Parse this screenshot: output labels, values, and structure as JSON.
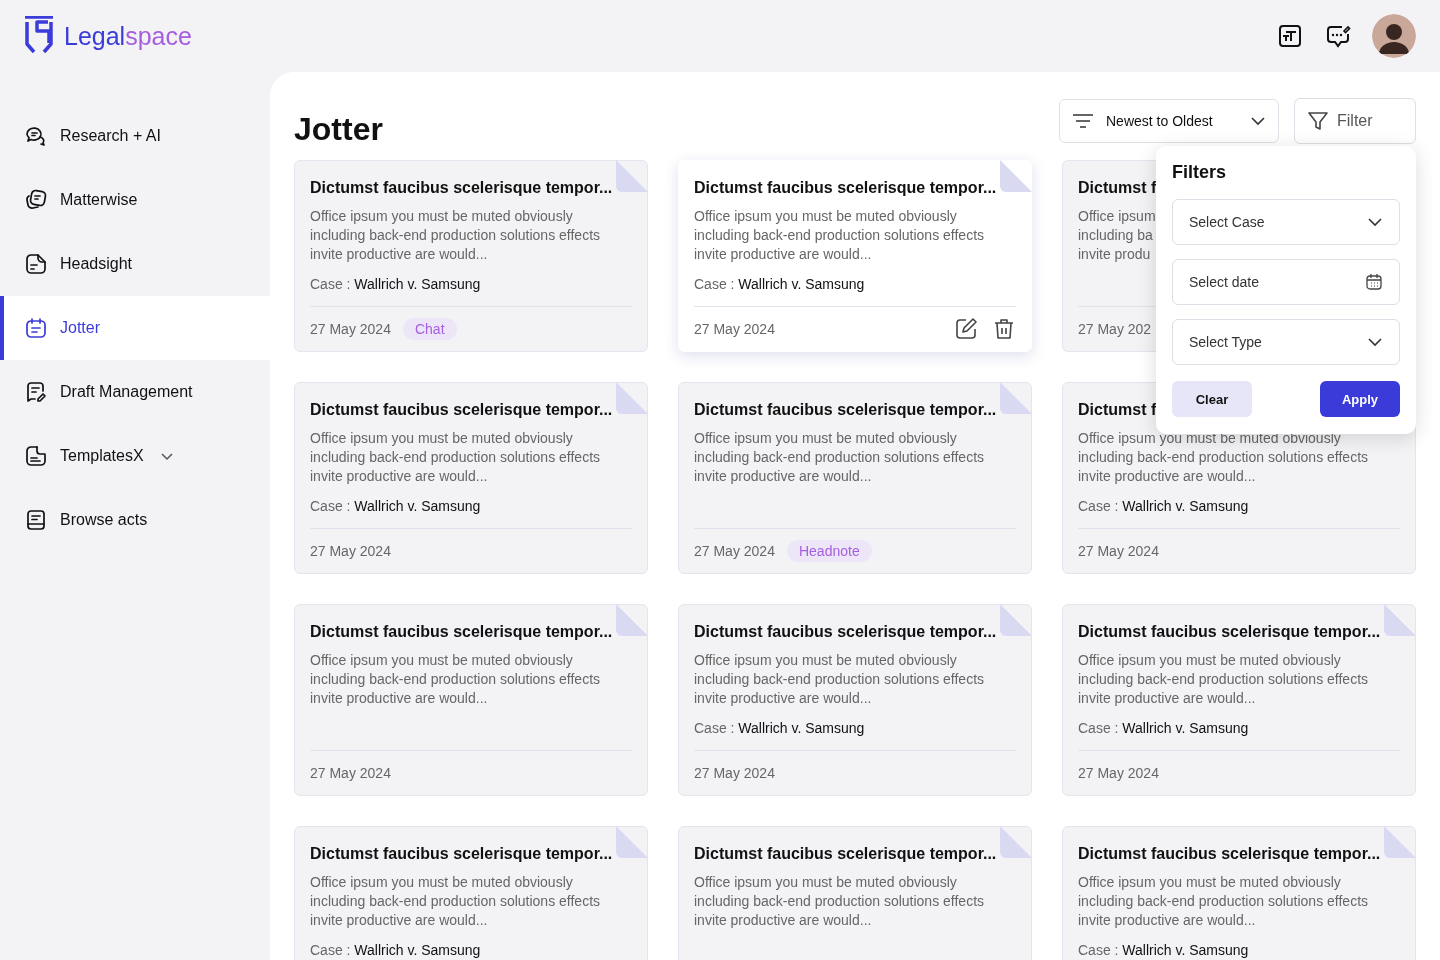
{
  "logo": {
    "part_1": "Legal",
    "part_2": "space"
  },
  "sidebar": {
    "items": [
      {
        "label": "Research + AI",
        "selected": false,
        "kind": "link"
      },
      {
        "label": "Matterwise",
        "selected": false,
        "kind": "link"
      },
      {
        "label": "Headsight",
        "selected": false,
        "kind": "link"
      },
      {
        "label": "Jotter",
        "selected": true,
        "kind": "link"
      },
      {
        "label": "Draft Management",
        "selected": false,
        "kind": "link"
      },
      {
        "label": "TemplatesX",
        "selected": false,
        "kind": "group"
      },
      {
        "label": "Browse acts",
        "selected": false,
        "kind": "link"
      }
    ]
  },
  "page": {
    "title": "Jotter"
  },
  "sort": {
    "value": "Newest to Oldest"
  },
  "filter_button": {
    "label": "Filter"
  },
  "filters": {
    "title": "Filters",
    "case_placeholder": "Select Case",
    "date_placeholder": "Select date",
    "type_placeholder": "Select Type",
    "clear": "Clear",
    "apply": "Apply"
  },
  "cards": [
    {
      "title": "Dictumst faucibus scelerisque tempor...",
      "body": [
        "Office ipsum you must be muted obviously",
        "including back-end production solutions effects",
        "invite productive are would..."
      ],
      "case_label": "Case :",
      "case": "Wallrich v. Samsung",
      "date": "27 May 2024",
      "tag": "Chat",
      "highlighted": false,
      "kind": "full"
    },
    {
      "title": "Dictumst faucibus scelerisque tempor...",
      "body": [
        "Office ipsum you must be muted obviously",
        "including back-end production solutions effects",
        "invite productive are would..."
      ],
      "case_label": "Case :",
      "case": "Wallrich v. Samsung",
      "date": "27 May 2024",
      "highlighted": true,
      "kind": "full"
    },
    {
      "title": "Dictumst f",
      "body": [
        "Office ipsum",
        "including ba",
        "invite produ"
      ],
      "date": "27 May 202",
      "highlighted": false,
      "kind": "partial"
    },
    {
      "title": "Dictumst faucibus scelerisque tempor...",
      "body": [
        "Office ipsum you must be muted obviously",
        "including back-end production solutions effects",
        "invite productive are would..."
      ],
      "case_label": "Case :",
      "case": "Wallrich v. Samsung",
      "date": "27 May 2024",
      "highlighted": false,
      "kind": "full"
    },
    {
      "title": "Dictumst faucibus scelerisque tempor...",
      "body": [
        "Office ipsum you must be muted obviously",
        "including back-end production solutions effects",
        "invite productive are would..."
      ],
      "date": "27 May 2024",
      "tag": "Headnote",
      "highlighted": false,
      "kind": "full"
    },
    {
      "title": "Dictumst f",
      "body": [
        "Office ipsum you must be muted obviously",
        "including back-end production solutions effects",
        "invite productive are would..."
      ],
      "case_label": "Case :",
      "case": "Wallrich v. Samsung",
      "date": "27 May 2024",
      "highlighted": false,
      "kind": "covered"
    },
    {
      "title": "Dictumst faucibus scelerisque tempor...",
      "body": [
        "Office ipsum you must be muted obviously",
        "including back-end production solutions effects",
        "invite productive are would..."
      ],
      "date": "27 May 2024",
      "highlighted": false,
      "kind": "full"
    },
    {
      "title": "Dictumst faucibus scelerisque tempor...",
      "body": [
        "Office ipsum you must be muted obviously",
        "including back-end production solutions effects",
        "invite productive are would..."
      ],
      "case_label": "Case :",
      "case": "Wallrich v. Samsung",
      "date": "27 May 2024",
      "highlighted": false,
      "kind": "full"
    },
    {
      "title": "Dictumst faucibus scelerisque tempor...",
      "body": [
        "Office ipsum you must be muted obviously",
        "including back-end production solutions effects",
        "invite productive are would..."
      ],
      "case_label": "Case :",
      "case": "Wallrich v. Samsung",
      "date": "27 May 2024",
      "highlighted": false,
      "kind": "full"
    },
    {
      "title": "Dictumst faucibus scelerisque tempor...",
      "body": [
        "Office ipsum you must be muted obviously",
        "including back-end production solutions effects",
        "invite productive are would..."
      ],
      "case_label": "Case :",
      "case": "Wallrich v. Samsung",
      "highlighted": false,
      "kind": "full"
    },
    {
      "title": "Dictumst faucibus scelerisque tempor...",
      "body": [
        "Office ipsum you must be muted obviously",
        "including back-end production solutions effects",
        "invite productive are would..."
      ],
      "highlighted": false,
      "kind": "full"
    },
    {
      "title": "Dictumst faucibus scelerisque tempor...",
      "body": [
        "Office ipsum you must be muted obviously",
        "including back-end production solutions effects",
        "invite productive are would..."
      ],
      "case_label": "Case :",
      "case": "Wallrich v. Samsung",
      "highlighted": false,
      "kind": "full"
    }
  ]
}
